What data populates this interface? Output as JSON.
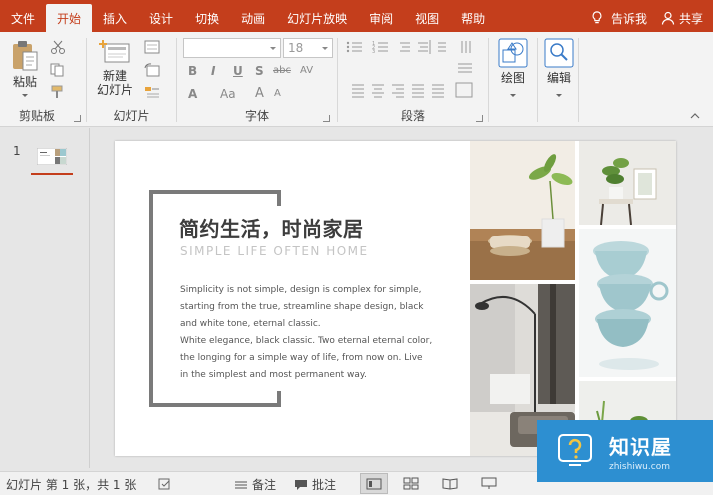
{
  "tabs": [
    "文件",
    "开始",
    "插入",
    "设计",
    "切换",
    "动画",
    "幻灯片放映",
    "审阅",
    "视图",
    "帮助"
  ],
  "active_tab": "开始",
  "tell_me": "告诉我",
  "share": "共享",
  "ribbon": {
    "clipboard": {
      "paste": "粘贴",
      "label": "剪贴板"
    },
    "slides": {
      "new_line1": "新建",
      "new_line2": "幻灯片",
      "label": "幻灯片"
    },
    "font": {
      "label": "字体",
      "size": "18",
      "bold": "B",
      "italic": "I",
      "underline": "U",
      "shadow": "S",
      "strike": "abc",
      "spacing": "AV",
      "color": "A",
      "case": "Aa",
      "grow": "A",
      "shrink": "A"
    },
    "paragraph": {
      "label": "段落"
    },
    "drawing": {
      "label": "绘图"
    },
    "editing": {
      "label": "编辑"
    }
  },
  "thumbnail": {
    "number": "1"
  },
  "slide": {
    "title": "简约生活，时尚家居",
    "subtitle": "SIMPLE LIFE OFTEN HOME",
    "body": [
      "Simplicity is not simple, design is complex for simple,",
      "starting from the true, streamline shape design, black",
      "and white tone, eternal classic.",
      "White elegance, black classic. Two eternal eternal color,",
      "the longing for a simple way of life, from now on. Live",
      "in the simplest and most permanent way."
    ]
  },
  "status": {
    "slide_info": "幻灯片 第 1 张，共 1 张",
    "notes": "备注",
    "comments": "批注"
  },
  "watermark": {
    "title": "知识屋",
    "url": "zhishiwu.com"
  },
  "colors": {
    "accent": "#c43e1c",
    "watermark": "#2d8fd1"
  }
}
